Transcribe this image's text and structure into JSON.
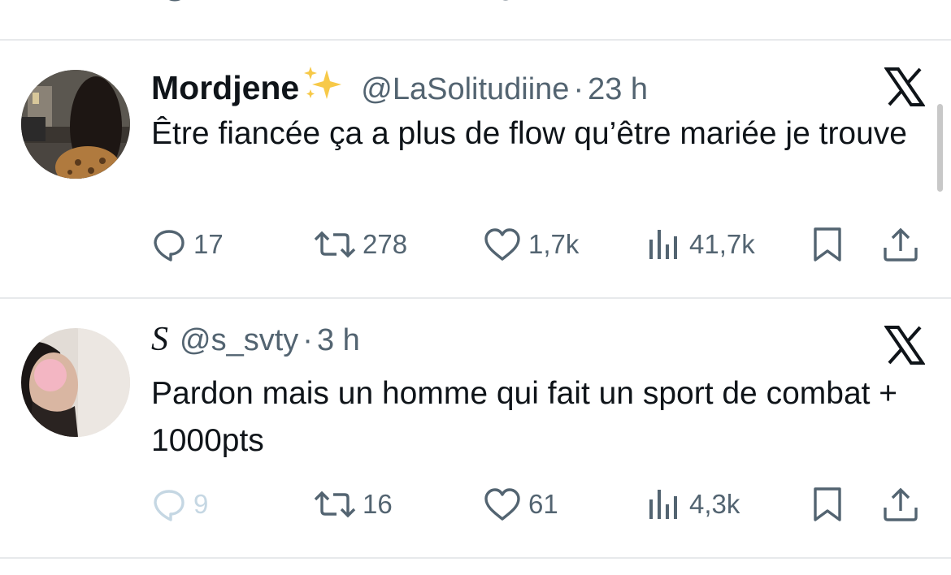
{
  "tweets": [
    {
      "display_name": "Mordjene",
      "name_emoji": "sparkles-icon",
      "handle": "@LaSolitudiine",
      "separator": "·",
      "time": "23 h",
      "text": "Être fiancée ça a plus de flow qu’être mariée je trouve",
      "counts": {
        "replies": "17",
        "retweets": "278",
        "likes": "1,7k",
        "views": "41,7k"
      }
    },
    {
      "display_name": "S",
      "handle": "@s_svty",
      "separator": "·",
      "time": "3 h",
      "text": "Pardon mais un homme qui fait un sport de combat + 1000pts",
      "counts": {
        "replies": "9",
        "retweets": "16",
        "likes": "61",
        "views": "4,3k"
      }
    }
  ],
  "icons": {
    "reply": "reply-icon",
    "retweet": "retweet-icon",
    "like": "like-icon",
    "views": "views-icon",
    "bookmark": "bookmark-icon",
    "share": "share-icon",
    "brand": "x-logo-icon"
  },
  "colors": {
    "text_primary": "#0f1419",
    "text_secondary": "#536471",
    "divider": "#e7e9eb",
    "faded_reply": "#c5d7e3"
  }
}
